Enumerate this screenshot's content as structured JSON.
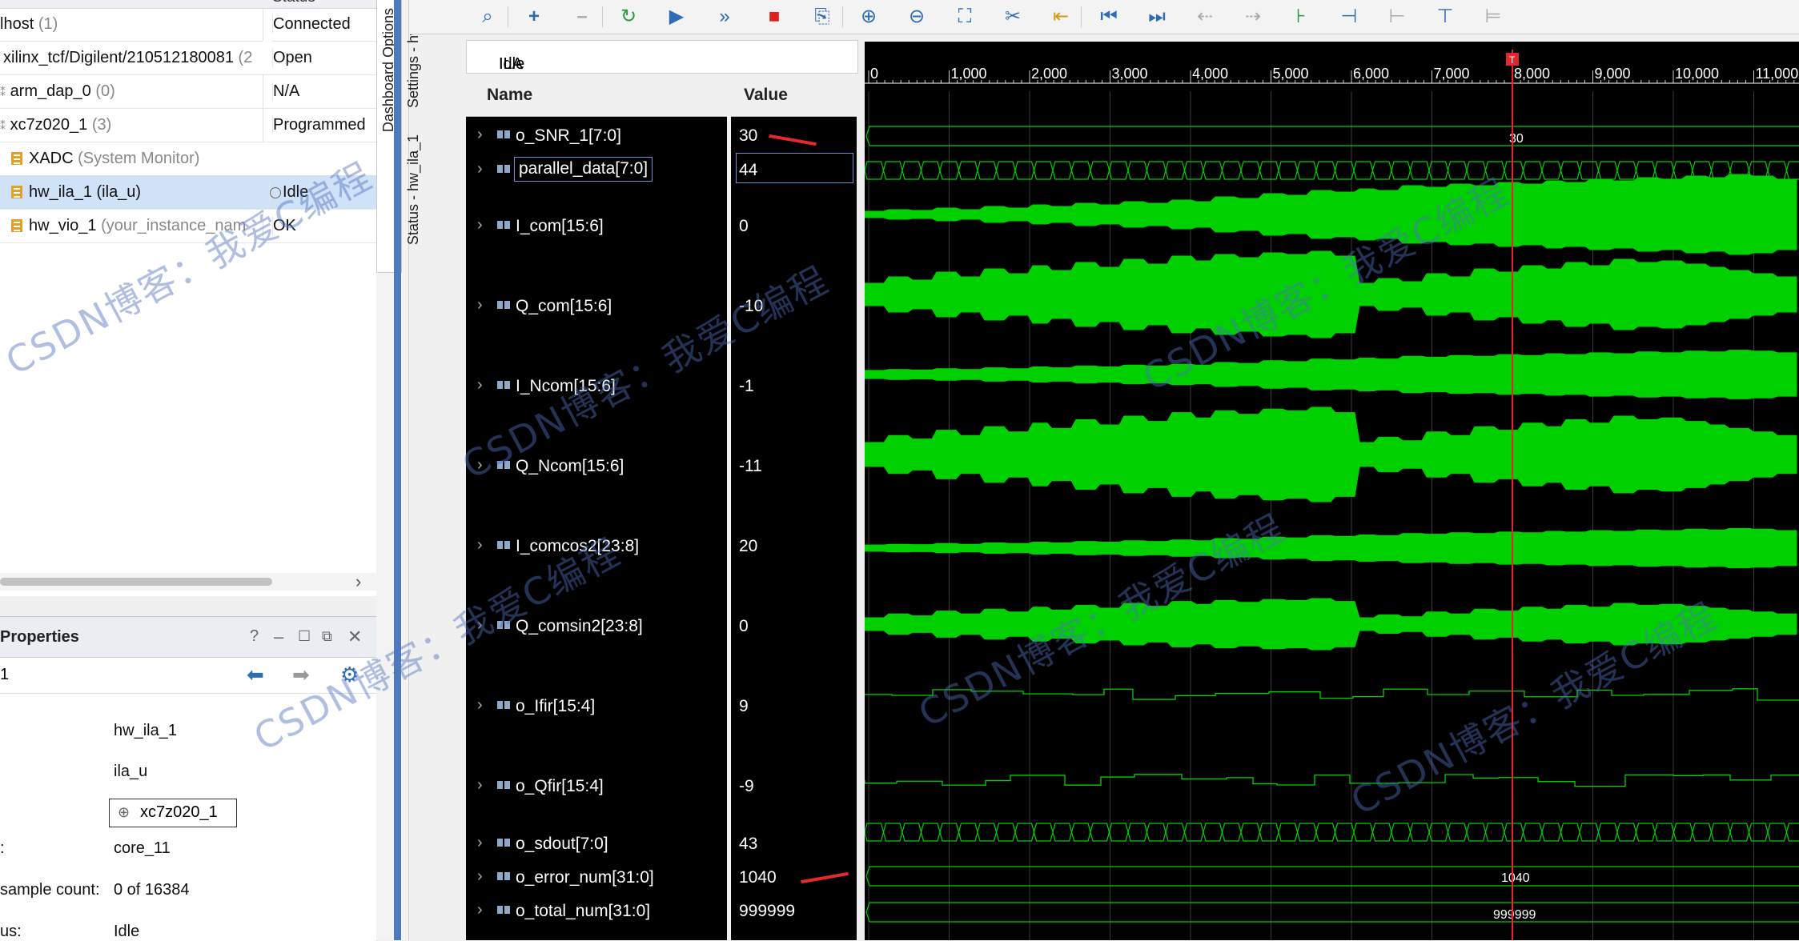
{
  "hardware": {
    "status_header": "Status",
    "rows": [
      {
        "name": "lhost",
        "count": "(1)",
        "status": "Connected",
        "indent": 0
      },
      {
        "name": "xilinx_tcf/Digilent/210512180081",
        "count": "",
        "status": "Open",
        "indent": 0
      },
      {
        "name": "arm_dap_0",
        "count": "(0)",
        "status": "N/A",
        "indent": 0
      },
      {
        "name": "xc7z020_1",
        "count": "(3)",
        "status": "Programmed",
        "indent": 0
      },
      {
        "name": "XADC",
        "count": "(System Monitor)",
        "status": "",
        "indent": 1
      },
      {
        "name": "hw_ila_1",
        "count": "(ila_u)",
        "status": "Idle",
        "indent": 1
      },
      {
        "name": "hw_vio_1",
        "count": "(your_instance_nam",
        "status": "OK",
        "indent": 1
      }
    ]
  },
  "properties": {
    "title": "Properties",
    "selected": "1",
    "rows": [
      {
        "label": "",
        "value": "hw_ila_1"
      },
      {
        "label": "",
        "value": "ila_u"
      },
      {
        "label": "",
        "value": "xc7z020_1"
      },
      {
        "label": ":",
        "value": "core_11"
      },
      {
        "label": "sample count:",
        "value": "0 of 16384"
      },
      {
        "label": "us:",
        "value": "Idle"
      }
    ]
  },
  "tabs": {
    "dashboard": "Dashboard Options",
    "settings": "Settings - hw_",
    "status": "Status - hw_ila_1"
  },
  "ila": {
    "status_label": "ILA Status:",
    "status_value": "Idle",
    "name_header": "Name",
    "value_header": "Value",
    "cursor_sample": 8000,
    "signals": [
      {
        "name": "o_SNR_1[7:0]",
        "value": "30"
      },
      {
        "name": "parallel_data[7:0]",
        "value": "44"
      },
      {
        "name": "I_com[15:6]",
        "value": "0"
      },
      {
        "name": "Q_com[15:6]",
        "value": "-10"
      },
      {
        "name": "I_Ncom[15:6]",
        "value": "-1"
      },
      {
        "name": "Q_Ncom[15:6]",
        "value": "-11"
      },
      {
        "name": "I_comcos2[23:8]",
        "value": "20"
      },
      {
        "name": "Q_comsin2[23:8]",
        "value": "0"
      },
      {
        "name": "o_Ifir[15:4]",
        "value": "9"
      },
      {
        "name": "o_Qfir[15:4]",
        "value": "-9"
      },
      {
        "name": "o_sdout[7:0]",
        "value": "43"
      },
      {
        "name": "o_error_num[31:0]",
        "value": "1040"
      },
      {
        "name": "o_total_num[31:0]",
        "value": "999999"
      }
    ],
    "ruler_ticks": [
      "0",
      "1,000",
      "2,000",
      "3,000",
      "4,000",
      "5,000",
      "6,000",
      "7,000",
      "8,000",
      "9,000",
      "10,000",
      "11,000"
    ],
    "bus_labels": {
      "snr": "30",
      "error": "1040",
      "total": "999999"
    }
  },
  "watermark": "CSDN博客：我爱C编程",
  "colors": {
    "wave": "#00d000",
    "cursor": "#e0282d",
    "accent": "#4f7bbd"
  }
}
